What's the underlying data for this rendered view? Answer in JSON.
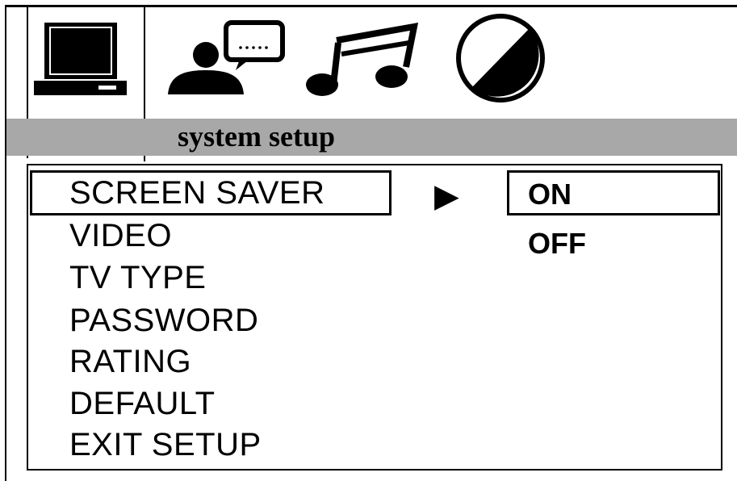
{
  "header": {
    "title": "system setup"
  },
  "tabs": [
    {
      "name": "system",
      "icon": "tv-monitor-icon",
      "selected": true
    },
    {
      "name": "language",
      "icon": "person-speech-icon",
      "selected": false
    },
    {
      "name": "audio",
      "icon": "music-note-icon",
      "selected": false
    },
    {
      "name": "video",
      "icon": "half-circle-icon",
      "selected": false
    }
  ],
  "menu": {
    "items": [
      "SCREEN SAVER",
      "VIDEO",
      "TV TYPE",
      "PASSWORD",
      "RATING",
      "DEFAULT",
      "EXIT SETUP"
    ],
    "selected_index": 0,
    "arrow": "▶"
  },
  "submenu": {
    "options": [
      "ON",
      "OFF"
    ],
    "selected_index": 0
  }
}
